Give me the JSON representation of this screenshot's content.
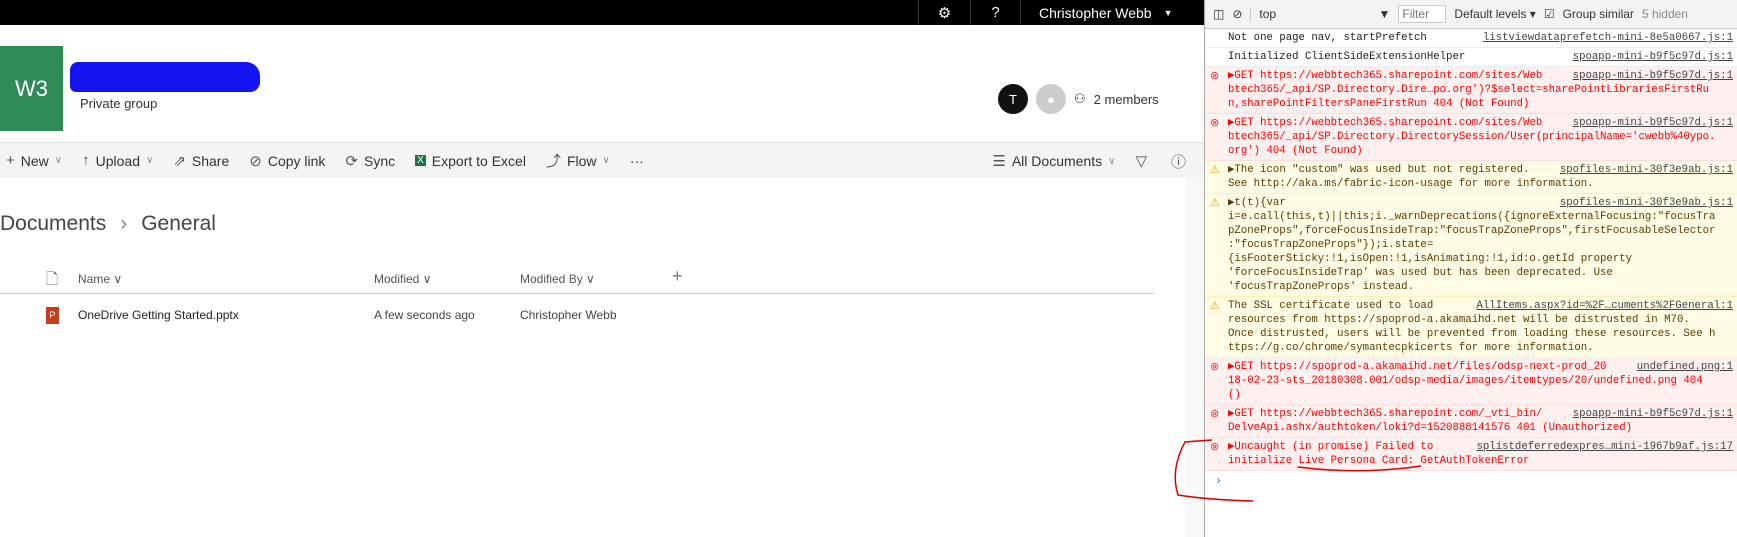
{
  "topbar": {
    "user": "Christopher Webb"
  },
  "site": {
    "logo": "W3",
    "privacy": "Private group",
    "members": "2 members",
    "avatar_initial": "T"
  },
  "toolbar": {
    "new": "New",
    "upload": "Upload",
    "share": "Share",
    "copy_link": "Copy link",
    "sync": "Sync",
    "export": "Export to Excel",
    "flow": "Flow",
    "more": "···",
    "view": "All Documents"
  },
  "breadcrumb": [
    "Documents",
    "General"
  ],
  "columns": {
    "name": "Name",
    "modified": "Modified",
    "modified_by": "Modified By",
    "add": "+"
  },
  "files": [
    {
      "name": "OneDrive Getting Started.pptx",
      "modified": "A few seconds ago",
      "modified_by": "Christopher Webb"
    }
  ],
  "devtools": {
    "context": "top",
    "filter_placeholder": "Filter",
    "levels": "Default levels ▾",
    "group_similar": "Group similar",
    "hidden": "5 hidden",
    "messages": [
      {
        "level": "info",
        "text": "Not one page nav, startPrefetch",
        "source": "listviewdataprefetch-mini-8e5a0667.js:1"
      },
      {
        "level": "info",
        "text": "Initialized ClientSideExtensionHelper",
        "source": "spoapp-mini-b9f5c97d.js:1"
      },
      {
        "level": "error",
        "text": "▶GET https://webbtech365.sharepoint.com/sites/Web\nbtech365/_api/SP.Directory.Dire…po.org')?$select=sharePointLibrariesFirstRu\nn,sharePointFiltersPaneFirstRun 404 (Not Found)",
        "source": "spoapp-mini-b9f5c97d.js:1"
      },
      {
        "level": "error",
        "text": "▶GET https://webbtech365.sharepoint.com/sites/Web\nbtech365/_api/SP.Directory.DirectorySession/User(principalName='cwebb%40ypo.\norg') 404 (Not Found)",
        "source": "spoapp-mini-b9f5c97d.js:1"
      },
      {
        "level": "warning",
        "text": "▶The icon \"custom\" was used but not registered.\nSee http://aka.ms/fabric-icon-usage for more information.",
        "source": "spofiles-mini-30f3e9ab.js:1"
      },
      {
        "level": "warning",
        "text": "▶t(t){var\ni=e.call(this,t)||this;i._warnDeprecations({ignoreExternalFocusing:\"focusTra\npZoneProps\",forceFocusInsideTrap:\"focusTrapZoneProps\",firstFocusableSelector\n:\"focusTrapZoneProps\"});i.state=\n{isFooterSticky:!1,isOpen:!1,isAnimating:!1,id:o.getId property\n'forceFocusInsideTrap' was used but has been deprecated. Use\n'focusTrapZoneProps' instead.",
        "source": "spofiles-mini-30f3e9ab.js:1"
      },
      {
        "level": "warning",
        "text": "The SSL certificate used to load\nresources from https://spoprod-a.akamaihd.net will be distrusted in M70.\nOnce distrusted, users will be prevented from loading these resources. See h\nttps://g.co/chrome/symantecpkicerts for more information.",
        "source": "AllItems.aspx?id=%2F…cuments%2FGeneral:1"
      },
      {
        "level": "error",
        "text": "▶GET https://spoprod-a.akamaihd.net/files/odsp-next-prod_20\n18-02-23-sts_20180308.001/odsp-media/images/itemtypes/20/undefined.png 404\n()",
        "source": "undefined.png:1"
      },
      {
        "level": "error",
        "text": "▶GET https://webbtech365.sharepoint.com/_vti_bin/\nDelveApi.ashx/authtoken/loki?d=1520888141576 401 (Unauthorized)",
        "source": "spoapp-mini-b9f5c97d.js:1"
      },
      {
        "level": "error",
        "text": "▶Uncaught (in promise) Failed to\ninitialize Live Persona Card: GetAuthTokenError",
        "source": "splistdeferredexpres…mini-1967b9af.js:17"
      }
    ]
  }
}
